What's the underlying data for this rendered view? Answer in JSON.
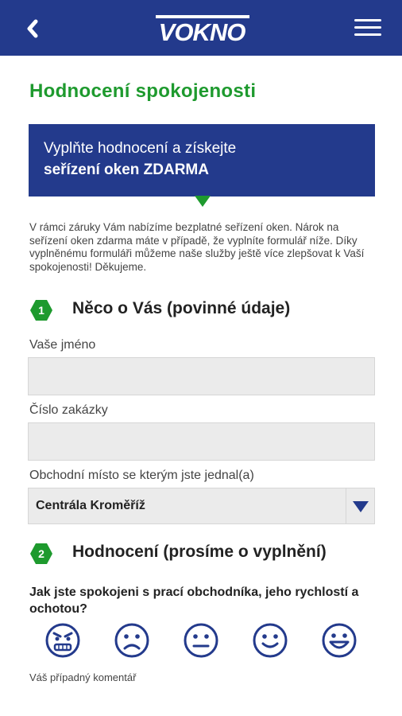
{
  "header": {
    "logo_text": "VOKNO",
    "back_icon": "chevron-left-icon",
    "menu_icon": "hamburger-menu-icon",
    "bg_color": "#233a8c"
  },
  "page_title": "Hodnocení spokojenosti",
  "promo": {
    "line1": "Vyplňte hodnocení a získejte",
    "line2": "seřízení oken ZDARMA"
  },
  "intro_text": "V rámci záruky Vám nabízíme bezplatné seřízení oken. Nárok na seřízení oken zdarma máte v případě, že vyplníte formulář níže. Díky vyplněnému formuláři můžeme naše služby ještě více zlepšovat k Vaší spokojenosti! Děkujeme.",
  "section1": {
    "number": "1",
    "title": "Něco o Vás (povinné údaje)"
  },
  "fields": {
    "name_label": "Vaše jméno",
    "name_value": "",
    "order_label": "Číslo zakázky",
    "order_value": "",
    "branch_label": "Obchodní místo se kterým jste jednal(a)",
    "branch_value": "Centrála Kroměříž"
  },
  "section2": {
    "number": "2",
    "title": "Hodnocení (prosíme o vyplnění)"
  },
  "question": "Jak jste spokojeni s prací obchodníka, jeho rychlostí a ochotou?",
  "rating_faces": [
    "angry-face-icon",
    "sad-face-icon",
    "neutral-face-icon",
    "smile-face-icon",
    "happy-face-icon"
  ],
  "comment_label": "Váš případný komentář",
  "colors": {
    "brand_blue": "#233a8c",
    "accent_green": "#1e9a2e"
  }
}
